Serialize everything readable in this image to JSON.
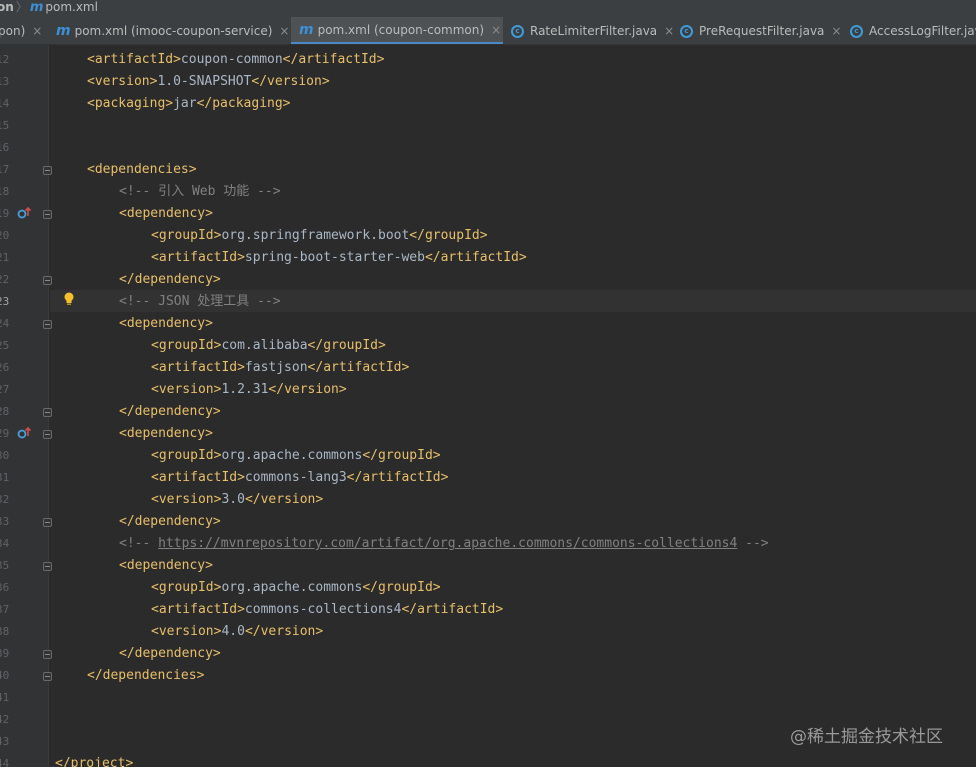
{
  "breadcrumb": {
    "module": "on",
    "file": "pom.xml"
  },
  "tabs": [
    {
      "label": "pon)",
      "type": "none"
    },
    {
      "label": "pom.xml (imooc-coupon-service)",
      "type": "maven"
    },
    {
      "label": "pom.xml (coupon-common)",
      "type": "maven",
      "active": true
    },
    {
      "label": "RateLimiterFilter.java",
      "type": "class"
    },
    {
      "label": "PreRequestFilter.java",
      "type": "class"
    },
    {
      "label": "AccessLogFilter.java",
      "type": "class"
    }
  ],
  "tab_close": "×",
  "maven_icon_glyph": "m",
  "class_icon_glyph": "c",
  "line_numbers": [
    "12",
    "13",
    "14",
    "15",
    "16",
    "17",
    "18",
    "19",
    "20",
    "21",
    "22",
    "23",
    "24",
    "25",
    "26",
    "27",
    "28",
    "29",
    "30",
    "31",
    "32",
    "33",
    "34",
    "35",
    "36",
    "37",
    "38",
    "39",
    "40",
    "41",
    "42",
    "43",
    "44"
  ],
  "current_line": "23",
  "code": {
    "l12": {
      "open": "<artifactId>",
      "text": "coupon-common",
      "close": "</artifactId>"
    },
    "l13": {
      "open": "<version>",
      "text": "1.0-SNAPSHOT",
      "close": "</version>"
    },
    "l14": {
      "open": "<packaging>",
      "text": "jar",
      "close": "</packaging>"
    },
    "l17": {
      "open": "<dependencies>"
    },
    "l18": {
      "comment": "<!-- 引入 Web 功能 -->"
    },
    "l19": {
      "open": "<dependency>"
    },
    "l20": {
      "open": "<groupId>",
      "text": "org.springframework.boot",
      "close": "</groupId>"
    },
    "l21": {
      "open": "<artifactId>",
      "text": "spring-boot-starter-web",
      "close": "</artifactId>"
    },
    "l22": {
      "close": "</dependency>"
    },
    "l23": {
      "comment": "<!-- JSON 处理工具 -->"
    },
    "l24": {
      "open": "<dependency>"
    },
    "l25": {
      "open": "<groupId>",
      "text": "com.alibaba",
      "close": "</groupId>"
    },
    "l26": {
      "open": "<artifactId>",
      "text": "fastjson",
      "close": "</artifactId>"
    },
    "l27": {
      "open": "<version>",
      "text": "1.2.31",
      "close": "</version>"
    },
    "l28": {
      "close": "</dependency>"
    },
    "l29": {
      "open": "<dependency>"
    },
    "l30": {
      "open": "<groupId>",
      "text": "org.apache.commons",
      "close": "</groupId>"
    },
    "l31": {
      "open": "<artifactId>",
      "text": "commons-lang3",
      "close": "</artifactId>"
    },
    "l32": {
      "open": "<version>",
      "text": "3.0",
      "close": "</version>"
    },
    "l33": {
      "close": "</dependency>"
    },
    "l34": {
      "comment_open": "<!-- ",
      "url": "https://mvnrepository.com/artifact/org.apache.commons/commons-collections4",
      "comment_close": " -->"
    },
    "l35": {
      "open": "<dependency>"
    },
    "l36": {
      "open": "<groupId>",
      "text": "org.apache.commons",
      "close": "</groupId>"
    },
    "l37": {
      "open": "<artifactId>",
      "text": "commons-collections4",
      "close": "</artifactId>"
    },
    "l38": {
      "open": "<version>",
      "text": "4.0",
      "close": "</version>"
    },
    "l39": {
      "close": "</dependency>"
    },
    "l40": {
      "close": "</dependencies>"
    },
    "l44": {
      "close": "</project>"
    }
  },
  "watermark": "@稀土掘金技术社区",
  "colors": {
    "tag": "#e8bf6a",
    "text": "#a9b7c6",
    "comment": "#808080",
    "background": "#2b2b2b",
    "gutter": "#313335",
    "accent": "#4a88c7"
  },
  "icons": {
    "gutter_run": "run-implementation-icon",
    "intention": "lightbulb-icon",
    "fold": "fold-marker-icon"
  }
}
